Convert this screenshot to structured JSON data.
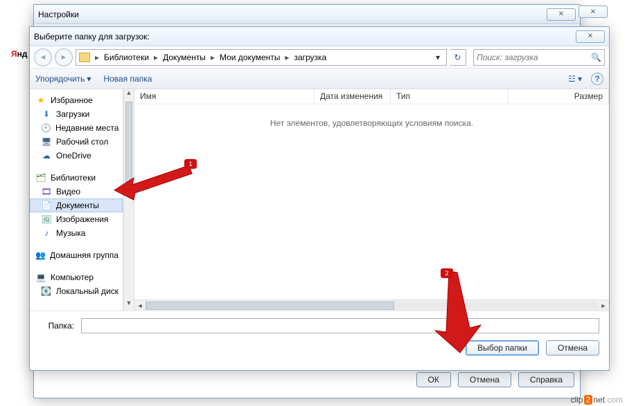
{
  "brand_partial": {
    "y": "Я",
    "rest": "нд"
  },
  "settings": {
    "title": "Настройки",
    "ok": "ОК",
    "cancel": "Отмена",
    "help": "Справка"
  },
  "dialog": {
    "title": "Выберите папку для загрузок:",
    "breadcrumb": [
      "Библиотеки",
      "Документы",
      "Мои документы",
      "загрузка"
    ],
    "search_placeholder": "Поиск: загрузка",
    "toolbar": {
      "organize": "Упорядочить",
      "newfolder": "Новая папка"
    },
    "columns": {
      "name": "Имя",
      "date": "Дата изменения",
      "type": "Тип",
      "size": "Размер"
    },
    "empty": "Нет элементов, удовлетворяющих условиям поиска.",
    "folder_label": "Папка:",
    "folder_value": "",
    "select": "Выбор папки",
    "cancel": "Отмена"
  },
  "nav": {
    "favorites": "Избранное",
    "downloads": "Загрузки",
    "recent": "Недавние места",
    "desktop": "Рабочий стол",
    "onedrive": "OneDrive",
    "libraries": "Библиотеки",
    "video": "Видео",
    "documents": "Документы",
    "pictures": "Изображения",
    "music": "Музыка",
    "homegroup": "Домашняя группа",
    "computer": "Компьютер",
    "localdisk": "Локальный диск"
  },
  "annotations": {
    "one": "1",
    "two": "2"
  },
  "watermark": "clip2net.com"
}
